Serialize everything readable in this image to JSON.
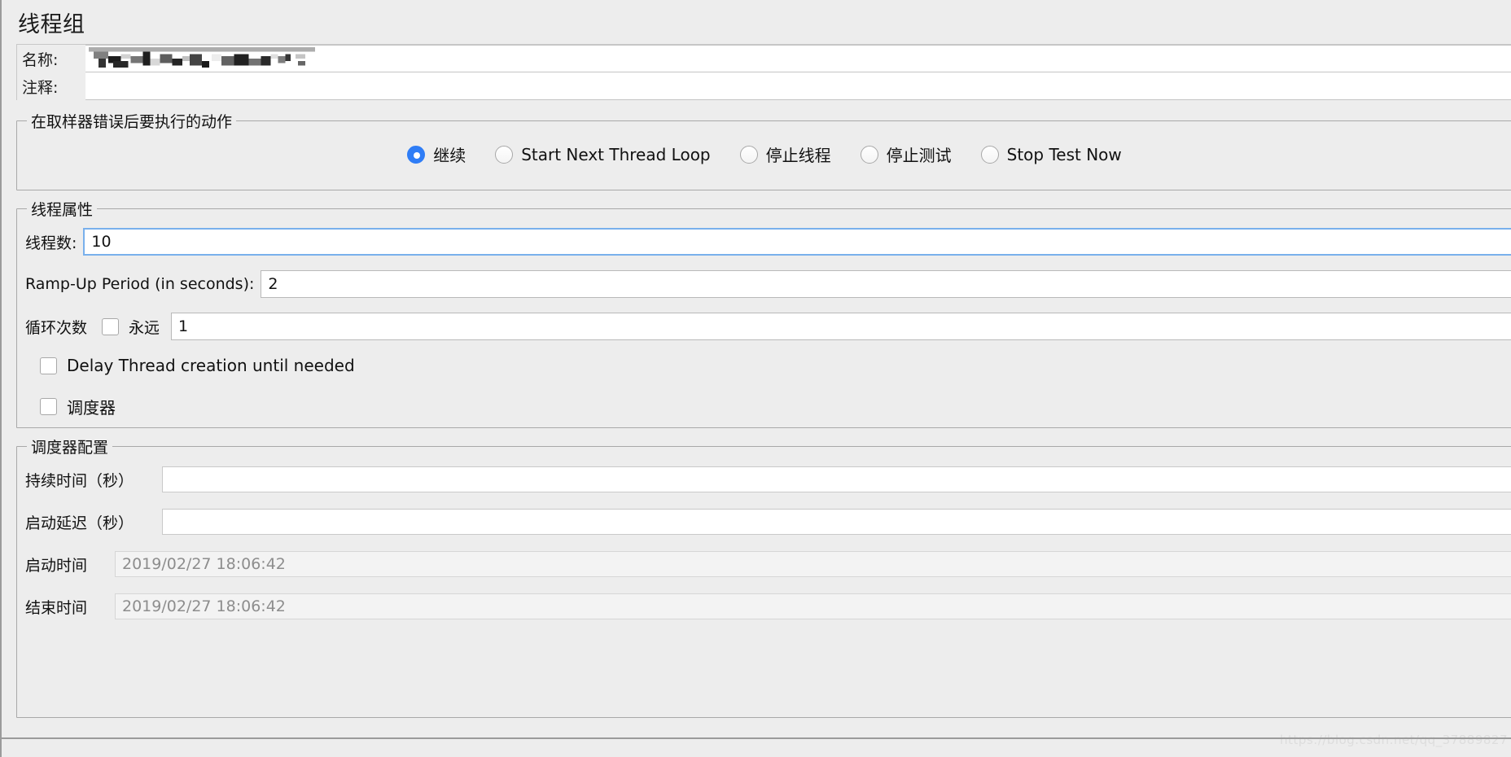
{
  "window": {
    "title": "线程组"
  },
  "top_form": {
    "name_label": "名称:",
    "name_value": "",
    "comments_label": "注释:",
    "comments_value": ""
  },
  "error_action": {
    "group_title": "在取样器错误后要执行的动作",
    "selected": "继续",
    "options": [
      {
        "label": "继续",
        "checked": true
      },
      {
        "label": "Start Next Thread Loop",
        "checked": false
      },
      {
        "label": "停止线程",
        "checked": false
      },
      {
        "label": "停止测试",
        "checked": false
      },
      {
        "label": "Stop Test Now",
        "checked": false
      }
    ]
  },
  "thread_properties": {
    "group_title": "线程属性",
    "num_threads_label": "线程数:",
    "num_threads_value": "10",
    "ramp_up_label": "Ramp-Up Period (in seconds):",
    "ramp_up_value": "2",
    "loop_count_label": "循环次数",
    "forever_label": "永远",
    "forever_checked": false,
    "loop_count_value": "1",
    "delay_thread_label": "Delay Thread creation until needed",
    "delay_thread_checked": false,
    "scheduler_label": "调度器",
    "scheduler_checked": false
  },
  "scheduler_config": {
    "group_title": "调度器配置",
    "duration_label": "持续时间（秒）",
    "duration_value": "",
    "startup_delay_label": "启动延迟（秒）",
    "startup_delay_value": "",
    "start_time_label": "启动时间",
    "start_time_value": "2019/02/27 18:06:42",
    "end_time_label": "结束时间",
    "end_time_value": "2019/02/27 18:06:42"
  },
  "watermark": {
    "text": "https://blog.csdn.net/qq_37889827"
  },
  "colors": {
    "accent": "#2f7df6",
    "focus_border": "#79b0ec",
    "panel_bg": "#ededed",
    "field_bg": "#ffffff",
    "disabled_text": "#8d8d8d"
  }
}
